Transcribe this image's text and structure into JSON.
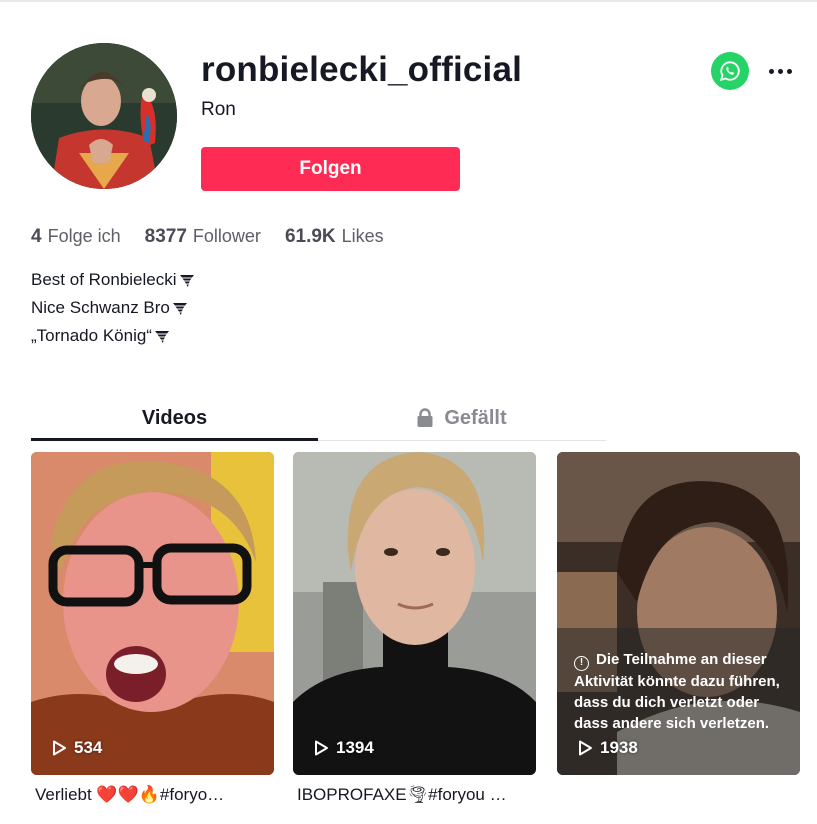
{
  "profile": {
    "username": "ronbielecki_official",
    "nickname": "Ron",
    "follow_label": "Folgen"
  },
  "stats": [
    {
      "value": "4",
      "label": "Folge ich"
    },
    {
      "value": "8377",
      "label": "Follower"
    },
    {
      "value": "61.9K",
      "label": "Likes"
    }
  ],
  "bio": [
    "Best of Ronbielecki",
    "Nice Schwanz Bro",
    "„Tornado König“ "
  ],
  "tabs": {
    "videos": "Videos",
    "liked": "Gefällt"
  },
  "videos": [
    {
      "views": "534",
      "caption": "Verliebt ❤️❤️🔥#foryo…"
    },
    {
      "views": "1394",
      "caption": "IBOPROFAXE🌪#foryou …"
    },
    {
      "views": "1938",
      "warning": "Die Teilnahme an dieser Aktivität könnte dazu führen, dass du dich verletzt oder dass andere sich verletzen."
    }
  ],
  "colors": {
    "accent": "#fe2c55",
    "whatsapp": "#25d366",
    "text": "#161823",
    "muted": "#8a8b91"
  },
  "icons": [
    "whatsapp-icon",
    "more-options-icon",
    "lock-icon",
    "play-icon",
    "info-icon",
    "tornado-icon"
  ]
}
